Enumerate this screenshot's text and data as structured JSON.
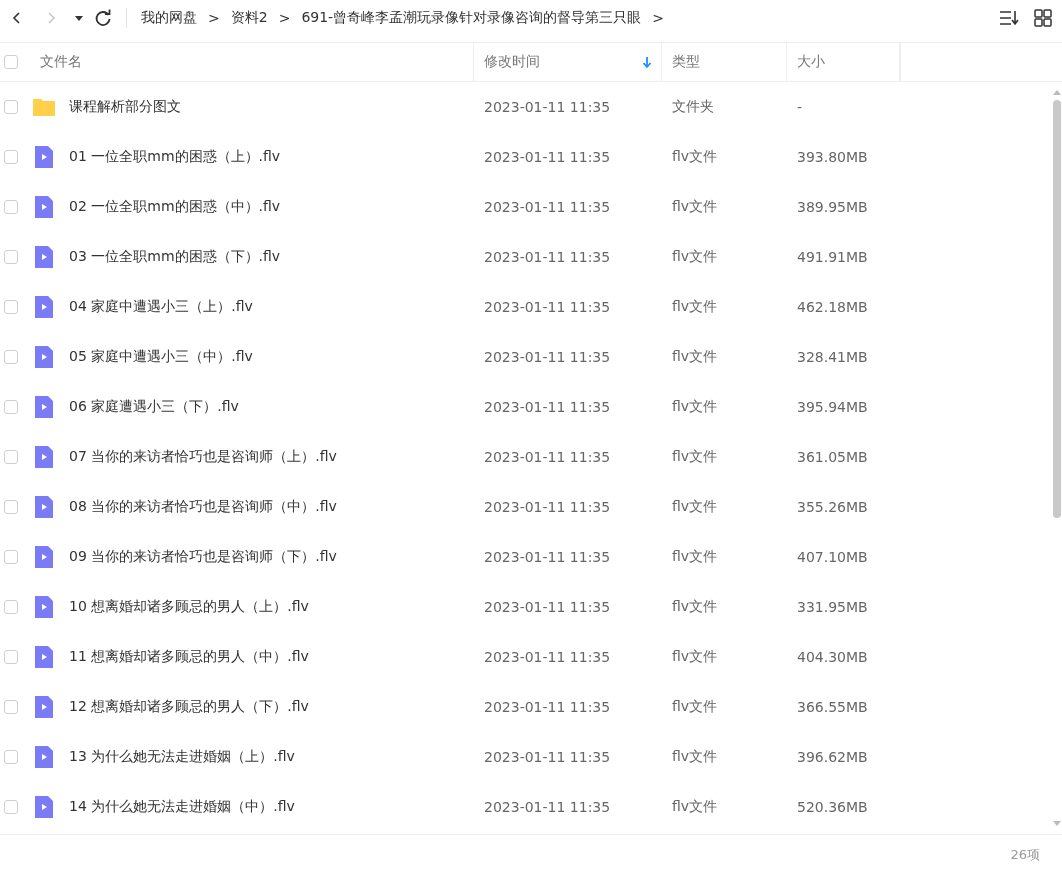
{
  "toolbar": {
    "back": {
      "disabled": false
    },
    "forward": {
      "disabled": true
    }
  },
  "breadcrumbs": [
    {
      "label": "我的网盘",
      "separator": ">"
    },
    {
      "label": "资料2",
      "separator": ">"
    },
    {
      "label": "691-曾奇峰李孟潮玩录像针对录像咨询的督导第三只眼",
      "separator": ">"
    }
  ],
  "table": {
    "columns": [
      {
        "label": "文件名",
        "sorted": false
      },
      {
        "label": "修改时间",
        "sorted": true
      },
      {
        "label": "类型",
        "sorted": false
      },
      {
        "label": "大小",
        "sorted": false
      }
    ],
    "all_checked": false,
    "rows": [
      {
        "kind": "folder",
        "name": "课程解析部分图文",
        "modified": "2023-01-11 11:35",
        "type": "文件夹",
        "size": "-",
        "checked": false
      },
      {
        "kind": "video",
        "name": "01 一位全职mm的困惑（上）.flv",
        "modified": "2023-01-11 11:35",
        "type": "flv文件",
        "size": "393.80MB",
        "checked": false
      },
      {
        "kind": "video",
        "name": "02 一位全职mm的困惑（中）.flv",
        "modified": "2023-01-11 11:35",
        "type": "flv文件",
        "size": "389.95MB",
        "checked": false
      },
      {
        "kind": "video",
        "name": "03 一位全职mm的困惑（下）.flv",
        "modified": "2023-01-11 11:35",
        "type": "flv文件",
        "size": "491.91MB",
        "checked": false
      },
      {
        "kind": "video",
        "name": "04 家庭中遭遇小三（上）.flv",
        "modified": "2023-01-11 11:35",
        "type": "flv文件",
        "size": "462.18MB",
        "checked": false
      },
      {
        "kind": "video",
        "name": "05 家庭中遭遇小三（中）.flv",
        "modified": "2023-01-11 11:35",
        "type": "flv文件",
        "size": "328.41MB",
        "checked": false
      },
      {
        "kind": "video",
        "name": "06 家庭遭遇小三（下）.flv",
        "modified": "2023-01-11 11:35",
        "type": "flv文件",
        "size": "395.94MB",
        "checked": false
      },
      {
        "kind": "video",
        "name": "07 当你的来访者恰巧也是咨询师（上）.flv",
        "modified": "2023-01-11 11:35",
        "type": "flv文件",
        "size": "361.05MB",
        "checked": false
      },
      {
        "kind": "video",
        "name": "08 当你的来访者恰巧也是咨询师（中）.flv",
        "modified": "2023-01-11 11:35",
        "type": "flv文件",
        "size": "355.26MB",
        "checked": false
      },
      {
        "kind": "video",
        "name": "09 当你的来访者恰巧也是咨询师（下）.flv",
        "modified": "2023-01-11 11:35",
        "type": "flv文件",
        "size": "407.10MB",
        "checked": false
      },
      {
        "kind": "video",
        "name": "10 想离婚却诸多顾忌的男人（上）.flv",
        "modified": "2023-01-11 11:35",
        "type": "flv文件",
        "size": "331.95MB",
        "checked": false
      },
      {
        "kind": "video",
        "name": "11 想离婚却诸多顾忌的男人（中）.flv",
        "modified": "2023-01-11 11:35",
        "type": "flv文件",
        "size": "404.30MB",
        "checked": false
      },
      {
        "kind": "video",
        "name": "12 想离婚却诸多顾忌的男人（下）.flv",
        "modified": "2023-01-11 11:35",
        "type": "flv文件",
        "size": "366.55MB",
        "checked": false
      },
      {
        "kind": "video",
        "name": "13 为什么她无法走进婚姻（上）.flv",
        "modified": "2023-01-11 11:35",
        "type": "flv文件",
        "size": "396.62MB",
        "checked": false
      },
      {
        "kind": "video",
        "name": "14 为什么她无法走进婚姻（中）.flv",
        "modified": "2023-01-11 11:35",
        "type": "flv文件",
        "size": "520.36MB",
        "checked": false
      }
    ]
  },
  "status_bar": {
    "count": "26项"
  }
}
